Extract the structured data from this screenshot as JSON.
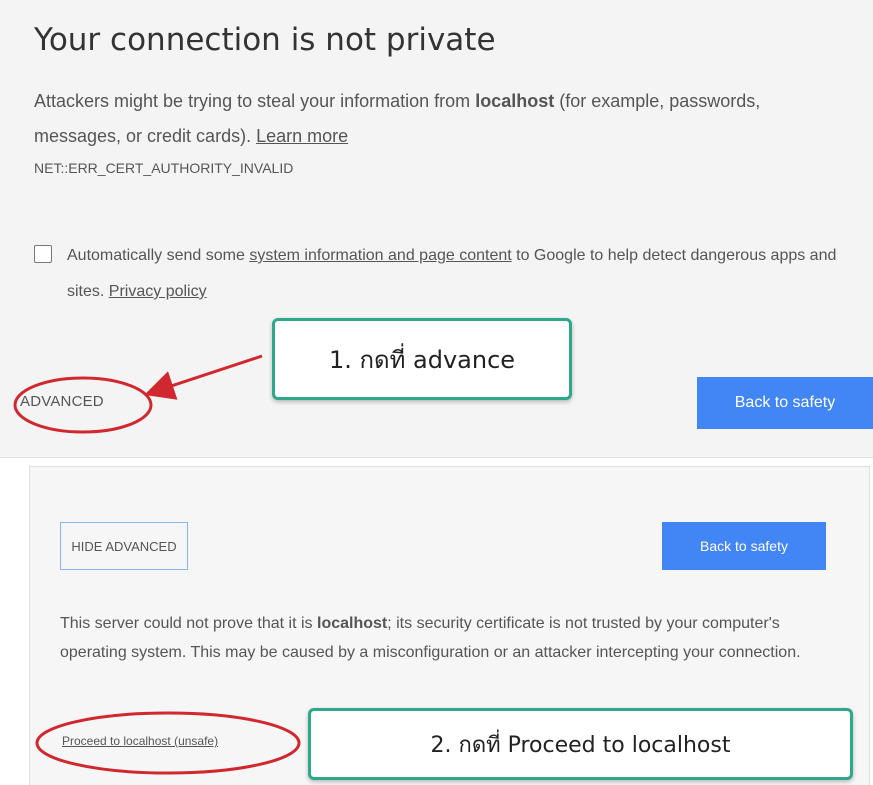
{
  "page": {
    "title": "Your connection is not private",
    "message": {
      "before": "Attackers might be trying to steal your information from ",
      "host": "localhost",
      "after": " (for example, passwords, messages, or credit cards). ",
      "learn_more": "Learn more"
    },
    "error_code": "NET::ERR_CERT_AUTHORITY_INVALID",
    "checkbox": {
      "checked": false,
      "before": "Automatically send some ",
      "link": "system information and page content",
      "after": " to Google to help detect dangerous apps and sites. ",
      "privacy_link": "Privacy policy"
    },
    "advanced_label": "ADVANCED",
    "back_to_safety_label": "Back to safety"
  },
  "advanced_panel": {
    "hide_advanced_label": "HIDE ADVANCED",
    "back_to_safety_label": "Back to safety",
    "explanation": {
      "before": "This server could not prove that it is ",
      "host": "localhost",
      "after": "; its security certificate is not trusted by your computer's operating system. This may be caused by a misconfiguration or an attacker intercepting your connection."
    },
    "proceed_link": "Proceed to localhost (unsafe)"
  },
  "annotations": {
    "step1": "1. กดที่ advance",
    "step2": "2. กดที่ Proceed to localhost",
    "accent_color": "#2da88a",
    "highlight_color": "#d0282e"
  },
  "colors": {
    "primary_button": "#4285f4",
    "background": "#f4f4f4"
  }
}
